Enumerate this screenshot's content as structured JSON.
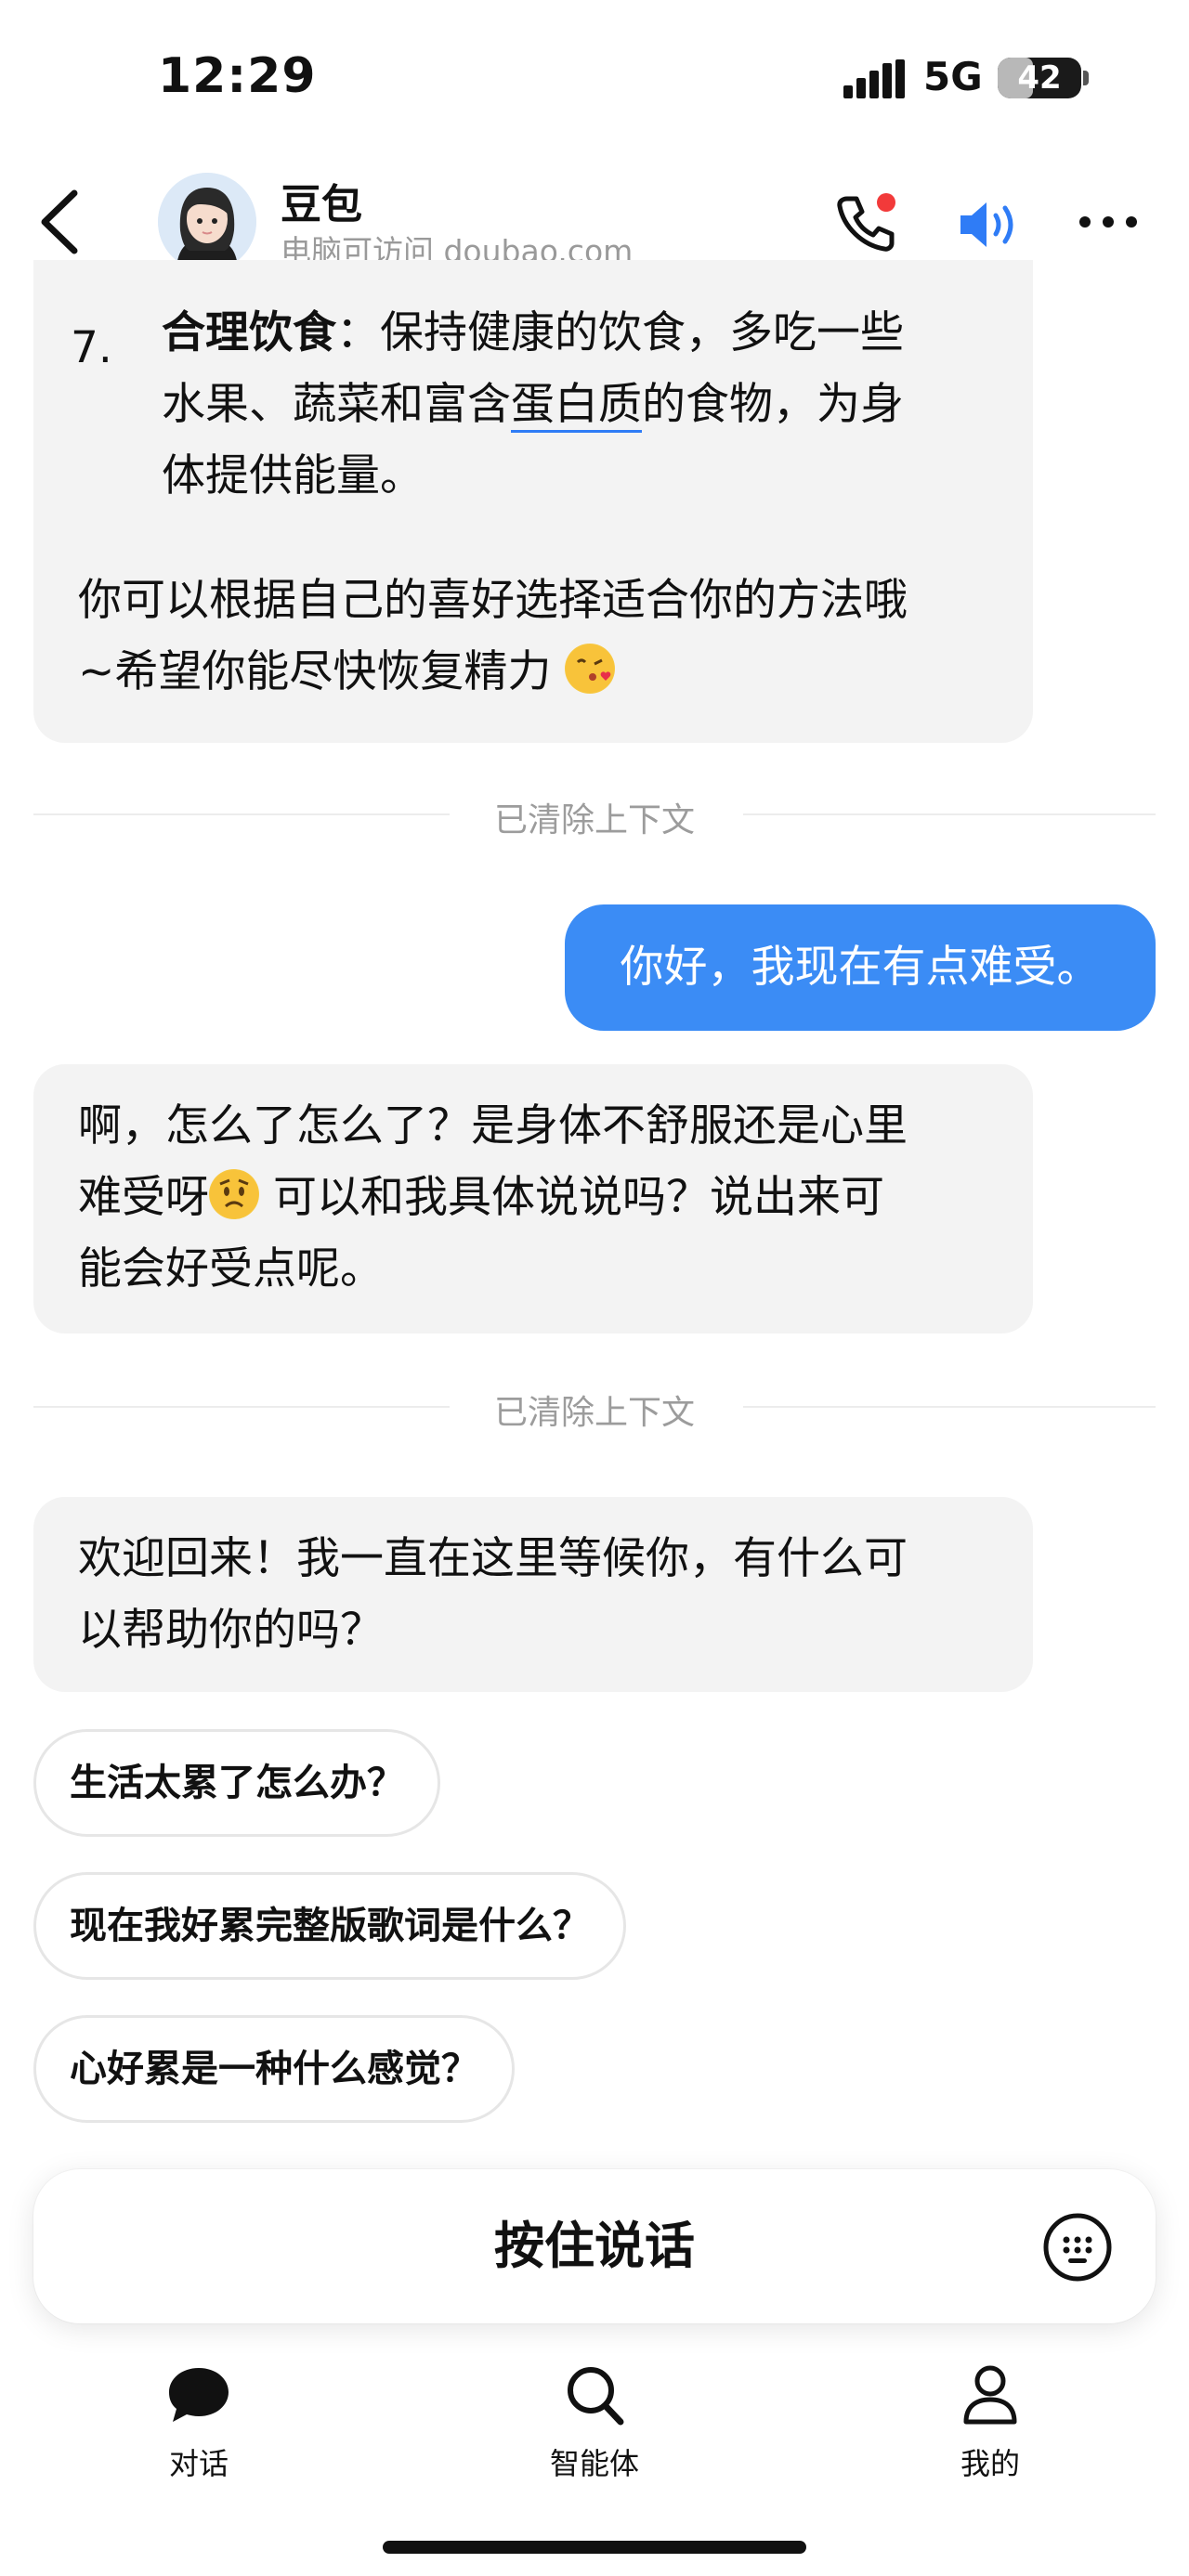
{
  "status_bar": {
    "time": "12:29",
    "network": "5G",
    "battery": "42",
    "battery_level_percent": 42
  },
  "header": {
    "title": "豆包",
    "subtitle": "电脑可访问 doubao.com",
    "icons": [
      "back-icon",
      "phone-call-icon",
      "speaker-icon",
      "more-icon"
    ],
    "accent_color": "#2f7cf6",
    "call_dot_color": "#f23a3a"
  },
  "messages": {
    "m1": {
      "item_number": "7.",
      "item_title": "合理饮食",
      "item_text_a": "：保持健康的饮食，多吃一些",
      "item_text_b": "水果、蔬菜和富含",
      "item_link": "蛋白质",
      "item_text_c": "的食物，为身",
      "item_text_d": "体提供能量。",
      "para_a": "你可以根据自己的喜好选择适合你的方法哦",
      "para_b": "~希望你能尽快恢复精力",
      "emoji": "face-blowing-kiss"
    },
    "divider1": "已清除上下文",
    "user": "你好，我现在有点难受。",
    "m2": {
      "line1": "啊，怎么了怎么了？是身体不舒服还是心里",
      "line2a": "难受呀",
      "line2b": " 可以和我具体说说吗？说出来可",
      "line3": "能会好受点呢。",
      "emoji": "worried-face"
    },
    "divider2": "已清除上下文",
    "m3": {
      "line1": "欢迎回来！我一直在这里等候你，有什么可",
      "line2": "以帮助你的吗？"
    }
  },
  "suggestions": [
    "生活太累了怎么办？",
    "现在我好累完整版歌词是什么？",
    "心好累是一种什么感觉？"
  ],
  "input": {
    "hold_to_talk": "按住说话",
    "keyboard_icon": "keyboard-icon"
  },
  "tabbar": {
    "items": [
      {
        "label": "对话",
        "icon": "chat-icon"
      },
      {
        "label": "智能体",
        "icon": "search-icon"
      },
      {
        "label": "我的",
        "icon": "profile-icon"
      }
    ]
  }
}
